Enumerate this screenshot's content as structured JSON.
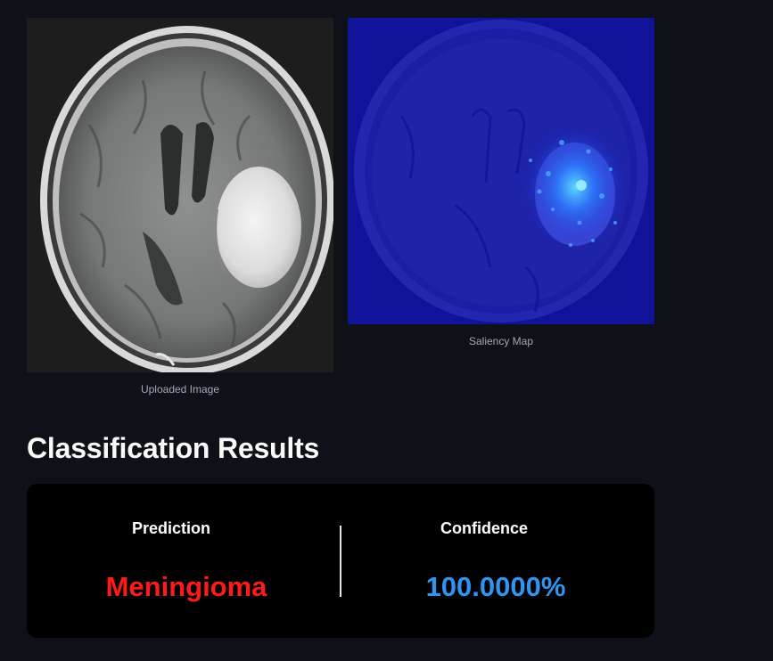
{
  "images": {
    "uploaded": {
      "caption": "Uploaded Image",
      "icon": "brain-mri-scan"
    },
    "saliency": {
      "caption": "Saliency Map",
      "icon": "saliency-heatmap"
    }
  },
  "results": {
    "title": "Classification Results",
    "prediction_label": "Prediction",
    "prediction_value": "Meningioma",
    "confidence_label": "Confidence",
    "confidence_value": "100.0000%"
  },
  "colors": {
    "background": "#0e1117",
    "card": "#000000",
    "prediction": "#ff1a1a",
    "confidence": "#2e95f0"
  }
}
